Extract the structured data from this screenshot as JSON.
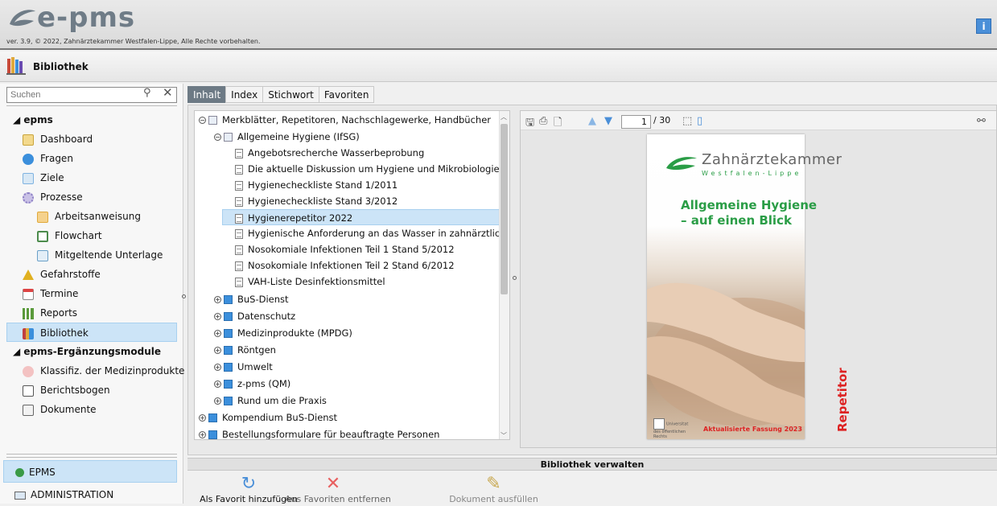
{
  "app": {
    "logo_text": "e-pms",
    "version": "ver. 3.9, © 2022, Zahnärztekammer Westfalen-Lippe, Alle Rechte vorbehalten.",
    "info_label": "i"
  },
  "page": {
    "title": "Bibliothek"
  },
  "sidebar": {
    "search_placeholder": "Suchen",
    "groups": [
      {
        "label": "epms"
      },
      {
        "label": "epms-Ergänzungsmodule"
      }
    ],
    "items": [
      {
        "label": "Dashboard",
        "icon": "dashboard-icon",
        "color": "#e8c15a"
      },
      {
        "label": "Fragen",
        "icon": "question-icon",
        "color": "#3b8fdc"
      },
      {
        "label": "Ziele",
        "icon": "goals-icon",
        "color": "#7fb3e0"
      },
      {
        "label": "Prozesse",
        "icon": "gear-icon",
        "color": "#8c7fc4"
      },
      {
        "label": "Arbeitsanweisung",
        "icon": "instruction-icon",
        "color": "#e0a93b"
      },
      {
        "label": "Flowchart",
        "icon": "flowchart-icon",
        "color": "#4c8b4c"
      },
      {
        "label": "Mitgeltende Unterlage",
        "icon": "document-icon",
        "color": "#6aa0c8"
      },
      {
        "label": "Gefahrstoffe",
        "icon": "warning-icon",
        "color": "#e0b020"
      },
      {
        "label": "Termine",
        "icon": "calendar-icon",
        "color": "#d44"
      },
      {
        "label": "Reports",
        "icon": "reports-icon",
        "color": "#5a9a3a"
      },
      {
        "label": "Bibliothek",
        "icon": "library-icon",
        "color": "#c04040"
      },
      {
        "label": "Klassifiz. der Medizinprodukte",
        "icon": "stethoscope-icon",
        "color": "#c05050"
      },
      {
        "label": "Berichtsbogen",
        "icon": "edit-form-icon",
        "color": "#555"
      },
      {
        "label": "Dokumente",
        "icon": "documents-icon",
        "color": "#666"
      }
    ],
    "bottom": [
      {
        "label": "EPMS",
        "icon": "epms-icon"
      },
      {
        "label": "ADMINISTRATION",
        "icon": "monitor-icon"
      }
    ]
  },
  "tabs": [
    "Inhalt",
    "Index",
    "Stichwort",
    "Favoriten"
  ],
  "tree": {
    "root": "Merkblätter, Repetitoren, Nachschlagewerke, Handbücher",
    "sub": "Allgemeine Hygiene (IfSG)",
    "docs": [
      "Angebotsrecherche Wasserbeprobung",
      "Die aktuelle Diskussion um Hygiene und Mikrobiologie",
      "Hygienecheckliste Stand 1/2011",
      "Hygienecheckliste Stand 3/2012",
      "Hygienerepetitor 2022",
      "Hygienische Anforderung an das Wasser in zahnärztlichen Beh",
      "Nosokomiale Infektionen Teil 1 Stand 5/2012",
      "Nosokomiale Infektionen Teil 2 Stand 6/2012",
      "VAH-Liste Desinfektionsmittel"
    ],
    "folders": [
      "BuS-Dienst",
      "Datenschutz",
      "Medizinprodukte (MPDG)",
      "Röntgen",
      "Umwelt",
      "z-pms (QM)",
      "Rund um die Praxis"
    ],
    "top_folders": [
      "Kompendium BuS-Dienst",
      "Bestellungsformulare für beauftragte Personen"
    ]
  },
  "viewer": {
    "page_current": "1",
    "page_total": "/ 30",
    "cover": {
      "brand": "Zahnärztekammer",
      "brand_sub": "Westfalen-Lippe",
      "title_line1": "Allgemeine Hygiene",
      "title_line2": "– auf einen Blick",
      "side": "Repetitor",
      "footer": "Aktualisierte Fassung 2023",
      "nrw": "Universitat des öffentlichen Rechts"
    }
  },
  "manage": {
    "title": "Bibliothek verwalten",
    "actions": [
      {
        "label": "Als Favorit hinzufügen",
        "icon": "refresh-icon"
      },
      {
        "label": "Aus Favoriten entfernen",
        "icon": "remove-icon"
      },
      {
        "label": "Dokument ausfüllen",
        "icon": "pencil-icon"
      }
    ]
  }
}
